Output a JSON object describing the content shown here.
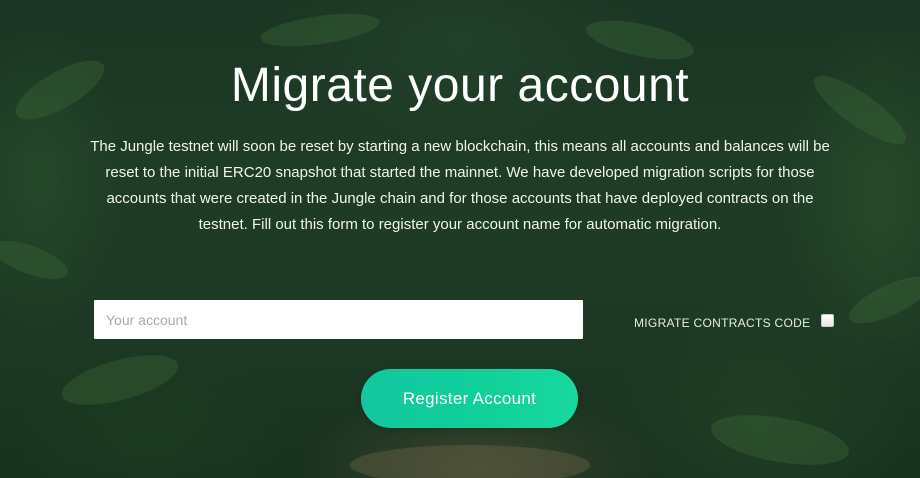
{
  "page": {
    "title": "Migrate your account",
    "description": "The Jungle testnet will soon be reset by starting a new blockchain, this means all accounts and balances will be reset to the initial ERC20 snapshot that started the mainnet. We have developed migration scripts for those accounts that were created in the Jungle chain and for those accounts that have deployed contracts on the testnet. Fill out this form to register your account name for automatic migration."
  },
  "form": {
    "account_placeholder": "Your account",
    "account_value": "",
    "migrate_contracts_label": "MIGRATE CONTRACTS CODE",
    "migrate_contracts_checked": false,
    "register_label": "Register Account"
  },
  "colors": {
    "accent": "#14c79f",
    "background": "#2a4a2f",
    "text": "#ffffff"
  }
}
